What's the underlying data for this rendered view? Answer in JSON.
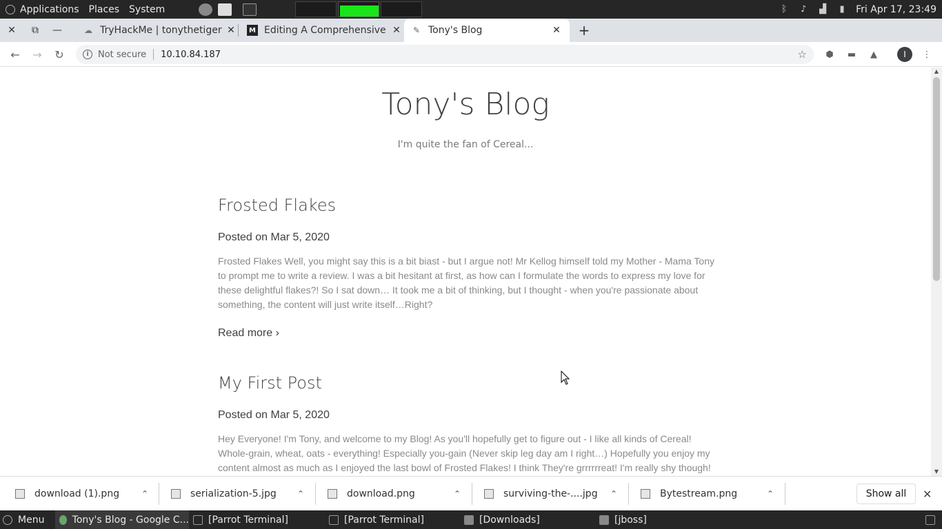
{
  "topbar": {
    "menus": [
      "Applications",
      "Places",
      "System"
    ],
    "clock": "Fri Apr 17, 23:49"
  },
  "tabs": [
    {
      "title": "TryHackMe | tonythetiger",
      "icon": "cloud-favicon"
    },
    {
      "title": "Editing A Comprehensive",
      "icon": "medium-favicon"
    },
    {
      "title": "Tony's Blog",
      "icon": "blog-favicon"
    }
  ],
  "omnibox": {
    "security": "Not secure",
    "url": "10.10.84.187"
  },
  "profile_initial": "I",
  "blog": {
    "title": "Tony's Blog",
    "subtitle": "I'm quite the fan of Cereal...",
    "posts": [
      {
        "title": "Frosted Flakes",
        "date": "Posted on Mar 5, 2020",
        "excerpt": "Frosted Flakes Well, you might say this is a bit biast - but I argue not! Mr Kellog himself told my Mother - Mama Tony to prompt me to write a review. I was a bit hesitant at first, as how can I formulate the words to express my love for these delightful flakes?! So I sat down… It took me a bit of thinking, but I thought - when you're passionate about something, the content will just write itself…Right?",
        "read_more": "Read more ›"
      },
      {
        "title": "My First Post",
        "date": "Posted on Mar 5, 2020",
        "excerpt": "Hey Everyone! I'm Tony, and welcome to my Blog! As you'll hopefully get to figure out - I like all kinds of Cereal! Whole-grain, wheat, oats - everything! Especially you-gain (Never skip leg day am I right…) Hopefully you enjoy my content almost as much as I enjoyed the last bowl of Frosted Flakes! I think They're grrrrrreat! I'm really shy though!"
      }
    ]
  },
  "downloads": {
    "items": [
      "download (1).png",
      "serialization-5.jpg",
      "download.png",
      "surviving-the-....jpg",
      "Bytestream.png"
    ],
    "show_all": "Show all"
  },
  "taskbar": {
    "menu": "Menu",
    "items": [
      "Tony's Blog - Google C...",
      "[Parrot Terminal]",
      "[Parrot Terminal]",
      "[Downloads]",
      "[jboss]"
    ]
  },
  "colors": {
    "panel": "#262626",
    "workspace_active": "#19e619",
    "tabstrip": "#dee1e6"
  }
}
